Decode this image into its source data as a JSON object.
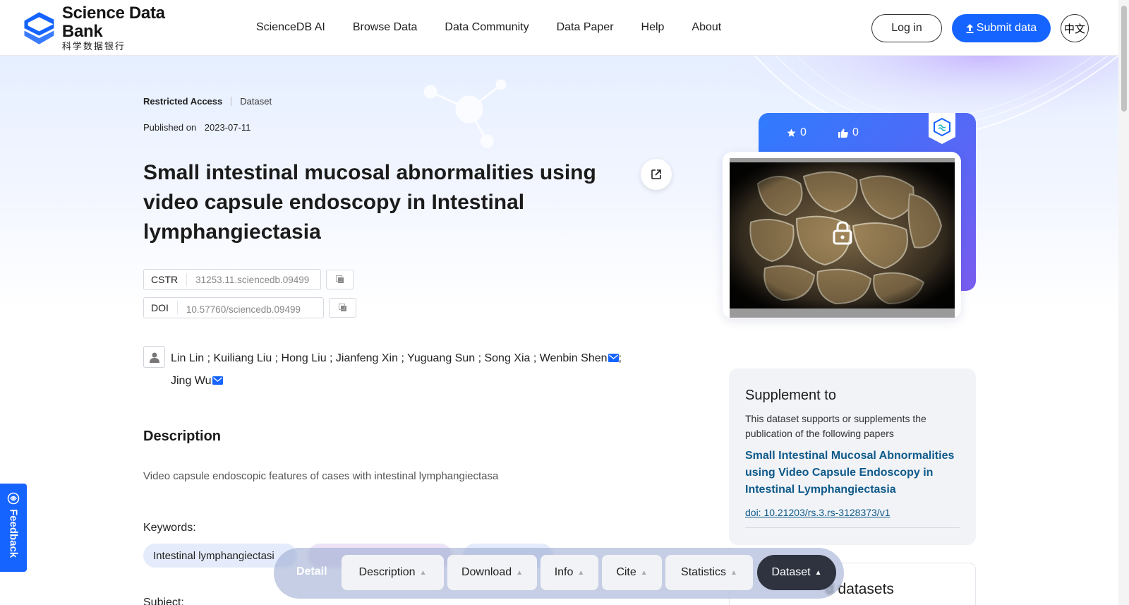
{
  "brand": {
    "name": "Science Data Bank",
    "name_cn": "科学数据银行",
    "color": "#1664ff"
  },
  "nav": {
    "items": [
      "ScienceDB AI",
      "Browse Data",
      "Data Community",
      "Data Paper",
      "Help",
      "About"
    ]
  },
  "header": {
    "login_label": "Log in",
    "submit_label": "Submit data",
    "lang_label": "中文"
  },
  "dataset": {
    "access": "Restricted Access",
    "type": "Dataset",
    "published_label": "Published on",
    "published_date": "2023-07-11",
    "title": "Small intestinal mucosal abnormalities using video capsule endoscopy in Intestinal lymphangiectasia",
    "cstr_label": "CSTR",
    "cstr_value": "31253.11.sciencedb.09499",
    "doi_label": "DOI",
    "doi_value": "10.57760/sciencedb.09499",
    "authors_line1": "Lin Lin ; Kuiliang Liu ; Hong Liu ; Jianfeng Xin ; Yuguang Sun ; Song Xia ; Wenbin Shen",
    "authors_sep": ";",
    "authors_line2": "Jing Wu",
    "description_heading": "Description",
    "description": "Video capsule endoscopic features of cases with intestinal lymphangiectasa",
    "keywords_label": "Keywords:",
    "keywords": [
      "Intestinal lymphangiectasi"
    ],
    "subject_label": "Subject:"
  },
  "stats": {
    "stars": "0",
    "likes": "0"
  },
  "supplement": {
    "heading": "Supplement to",
    "text": "This dataset supports or supplements the publication of the following papers",
    "paper_title": "Small Intestinal Mucosal Abnormalities using Video Capsule Endoscopy in Intestinal Lymphangiectasia",
    "paper_doi": "doi: 10.21203/rs.3.rs-3128373/v1"
  },
  "related": {
    "heading": "d datasets"
  },
  "section_nav": {
    "detail_label": "Detail",
    "tabs": [
      "Description",
      "Download",
      "Info",
      "Cite",
      "Statistics",
      "Dataset"
    ],
    "active": "Dataset"
  },
  "feedback_label": "Feedback",
  "icons": [
    "logo-icon",
    "upload-icon",
    "share-icon",
    "copy-icon",
    "user-icon",
    "mail-icon",
    "star-icon",
    "thumbs-up-icon",
    "badge-icon",
    "lock-icon",
    "feedback-icon",
    "chevron-up-icon"
  ]
}
